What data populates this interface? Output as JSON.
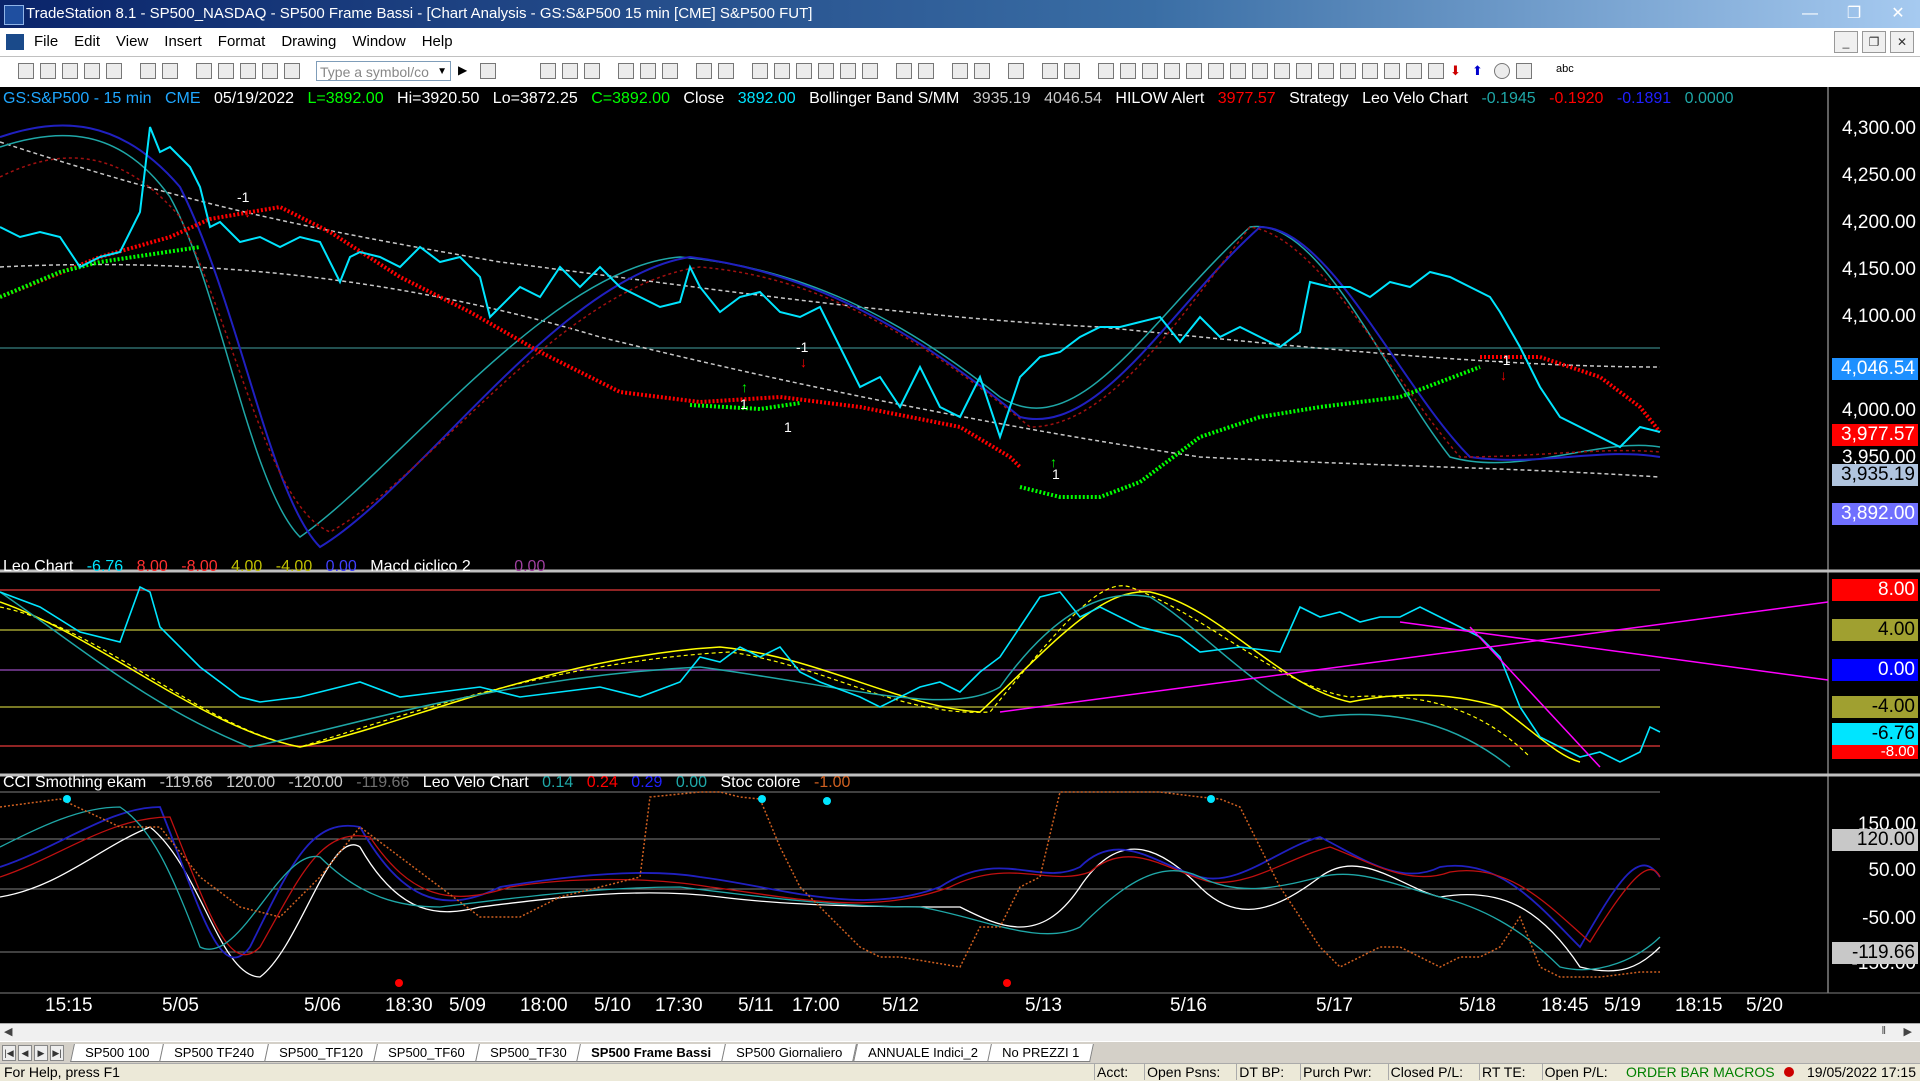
{
  "window": {
    "title": "TradeStation 8.1 - SP500_NASDAQ - SP500 Frame Bassi - [Chart Analysis - GS:S&P500  15 min  [CME] S&P500 FUT]"
  },
  "menu": [
    "File",
    "Edit",
    "View",
    "Insert",
    "Format",
    "Drawing",
    "Window",
    "Help"
  ],
  "toolbar": {
    "symbol_placeholder": "Type a symbol/co",
    "abc_label": "abc"
  },
  "price_panel": {
    "symbol": "GS:S&P500 - 15 min",
    "exchange": "CME",
    "date": "05/19/2022",
    "last": "L=3892.00",
    "high": "Hi=3920.50",
    "low": "Lo=3872.25",
    "close": "C=3892.00",
    "close_label": "Close",
    "close_value": "3892.00",
    "bb_label": "Bollinger Band S/MM",
    "bb_v1": "3935.19",
    "bb_v2": "4046.54",
    "hilow_label": "HILOW Alert",
    "hilow_value": "3977.57",
    "strategy_label": "Strategy",
    "leovelo_label": "Leo Velo Chart",
    "lv1": "-0.1945",
    "lv2": "-0.1920",
    "lv3": "-0.1891",
    "lv4": "0.0000",
    "axis_labels": [
      "4,300.00",
      "4,250.00",
      "4,200.00",
      "4,150.00",
      "4,100.00",
      "4,000.00",
      "3,950.00"
    ],
    "tags": {
      "t1": "4,046.54",
      "t2": "3,977.57",
      "t3": "3,935.19",
      "t4": "3,892.00"
    },
    "markers": {
      "m1": "-1",
      "m2": "1",
      "m3": "1",
      "m4": "-1",
      "m5": "1",
      "m6": "-1"
    }
  },
  "leo_panel": {
    "label": "Leo Chart",
    "v1": "-6.76",
    "v2": "8.00",
    "v3": "-8.00",
    "v4": "4.00",
    "v5": "-4.00",
    "v6": "0.00",
    "macd_label": "Macd ciclico 2",
    "macd_value": "0.00",
    "tags": {
      "t1": "8.00",
      "t2": "4.00",
      "t3": "0.00",
      "t4": "-4.00",
      "t5": "-6.76",
      "t6": "-8.00"
    }
  },
  "cci_panel": {
    "label": "CCI Smothing ekam",
    "v1": "-119.66",
    "v2": "120.00",
    "v3": "-120.00",
    "v4": "-119.66",
    "lv_label": "Leo Velo Chart",
    "lv1": "0.14",
    "lv2": "0.24",
    "lv3": "0.29",
    "lv4": "0.00",
    "stoc_label": "Stoc colore",
    "stoc_value": "-1.00",
    "axis_labels": [
      "150.00",
      "50.00",
      "-50.00",
      "-150.00"
    ],
    "tags": {
      "t1": "120.00",
      "t2": "-119.66"
    }
  },
  "time_axis": [
    "15:15",
    "5/05",
    "5/06",
    "18:30",
    "5/09",
    "18:00",
    "5/10",
    "17:30",
    "5/11",
    "17:00",
    "5/12",
    "5/13",
    "5/16",
    "5/17",
    "5/18",
    "18:45",
    "5/19",
    "18:15",
    "5/20"
  ],
  "tabs": [
    "SP500 100",
    "SP500 TF240",
    "SP500_TF120",
    "SP500_TF60",
    "SP500_TF30",
    "SP500 Frame Bassi",
    "SP500 Giornaliero",
    "ANNUALE Indici_2",
    "No PREZZI 1"
  ],
  "active_tab": "SP500 Frame Bassi",
  "status": {
    "help": "For Help, press F1",
    "fields": [
      "Acct:",
      "Open Psns:",
      "DT BP:",
      "Purch Pwr:",
      "Closed P/L:",
      "RT TE:",
      "Open P/L:"
    ],
    "order_bar": "ORDER BAR  MACROS",
    "datetime": "19/05/2022 17:15"
  },
  "colors": {
    "up": "#00ff00",
    "down": "#ff0000",
    "price": "#00e5ff",
    "magenta": "#ff00ff",
    "yellow": "#ffff00"
  }
}
